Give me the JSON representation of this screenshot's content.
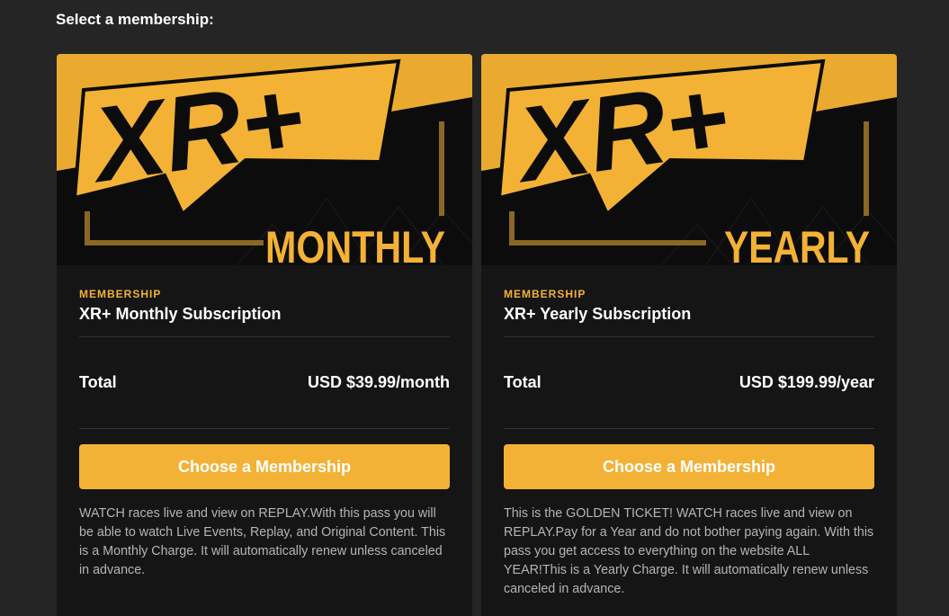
{
  "heading": "Select a membership:",
  "colors": {
    "accent": "#f3b236",
    "background": "#252525",
    "card": "#151515"
  },
  "memberships": [
    {
      "banner_logo": "XR+",
      "banner_word": "MONTHLY",
      "tag": "MEMBERSHIP",
      "name": "XR+ Monthly Subscription",
      "total_label": "Total",
      "price": "USD $39.99/month",
      "button_label": "Choose a Membership",
      "description": "WATCH races live and view on REPLAY.With this pass you will be able to watch Live Events, Replay, and Original Content. This is a Monthly Charge. It will automatically renew unless canceled in advance."
    },
    {
      "banner_logo": "XR+",
      "banner_word": "YEARLY",
      "tag": "MEMBERSHIP",
      "name": "XR+ Yearly Subscription",
      "total_label": "Total",
      "price": "USD $199.99/year",
      "button_label": "Choose a Membership",
      "description": "This is the GOLDEN TICKET! WATCH races live and view on REPLAY.Pay for a Year and do not bother paying again. With this pass you get access to everything on the website ALL YEAR!This is a Yearly Charge. It will automatically renew unless canceled in advance."
    }
  ]
}
